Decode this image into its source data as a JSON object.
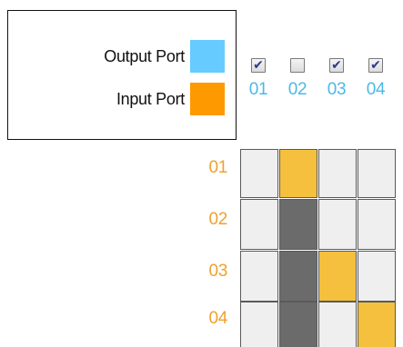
{
  "legend": {
    "output_label": "Output Port",
    "input_label": "Input Port",
    "output_color": "#66ccff",
    "input_color": "#ff9900"
  },
  "columns": [
    {
      "label": "01",
      "checked": true
    },
    {
      "label": "02",
      "checked": false
    },
    {
      "label": "03",
      "checked": true
    },
    {
      "label": "04",
      "checked": true
    }
  ],
  "rows": [
    {
      "label": "01"
    },
    {
      "label": "02"
    },
    {
      "label": "03"
    },
    {
      "label": "04"
    }
  ],
  "matrix": [
    [
      "empty",
      "active",
      "empty",
      "empty"
    ],
    [
      "empty",
      "dark",
      "empty",
      "empty"
    ],
    [
      "empty",
      "dark",
      "active",
      "empty"
    ],
    [
      "empty",
      "dark",
      "empty",
      "active"
    ]
  ],
  "colors": {
    "active": "#f4c03e",
    "disabled": "#6b6b6b",
    "empty": "#efefef",
    "column_label": "#4db8e8",
    "row_label": "#f0a030"
  },
  "icons": {
    "checked": "checkbox-checked-icon",
    "unchecked": "checkbox-unchecked-icon"
  }
}
